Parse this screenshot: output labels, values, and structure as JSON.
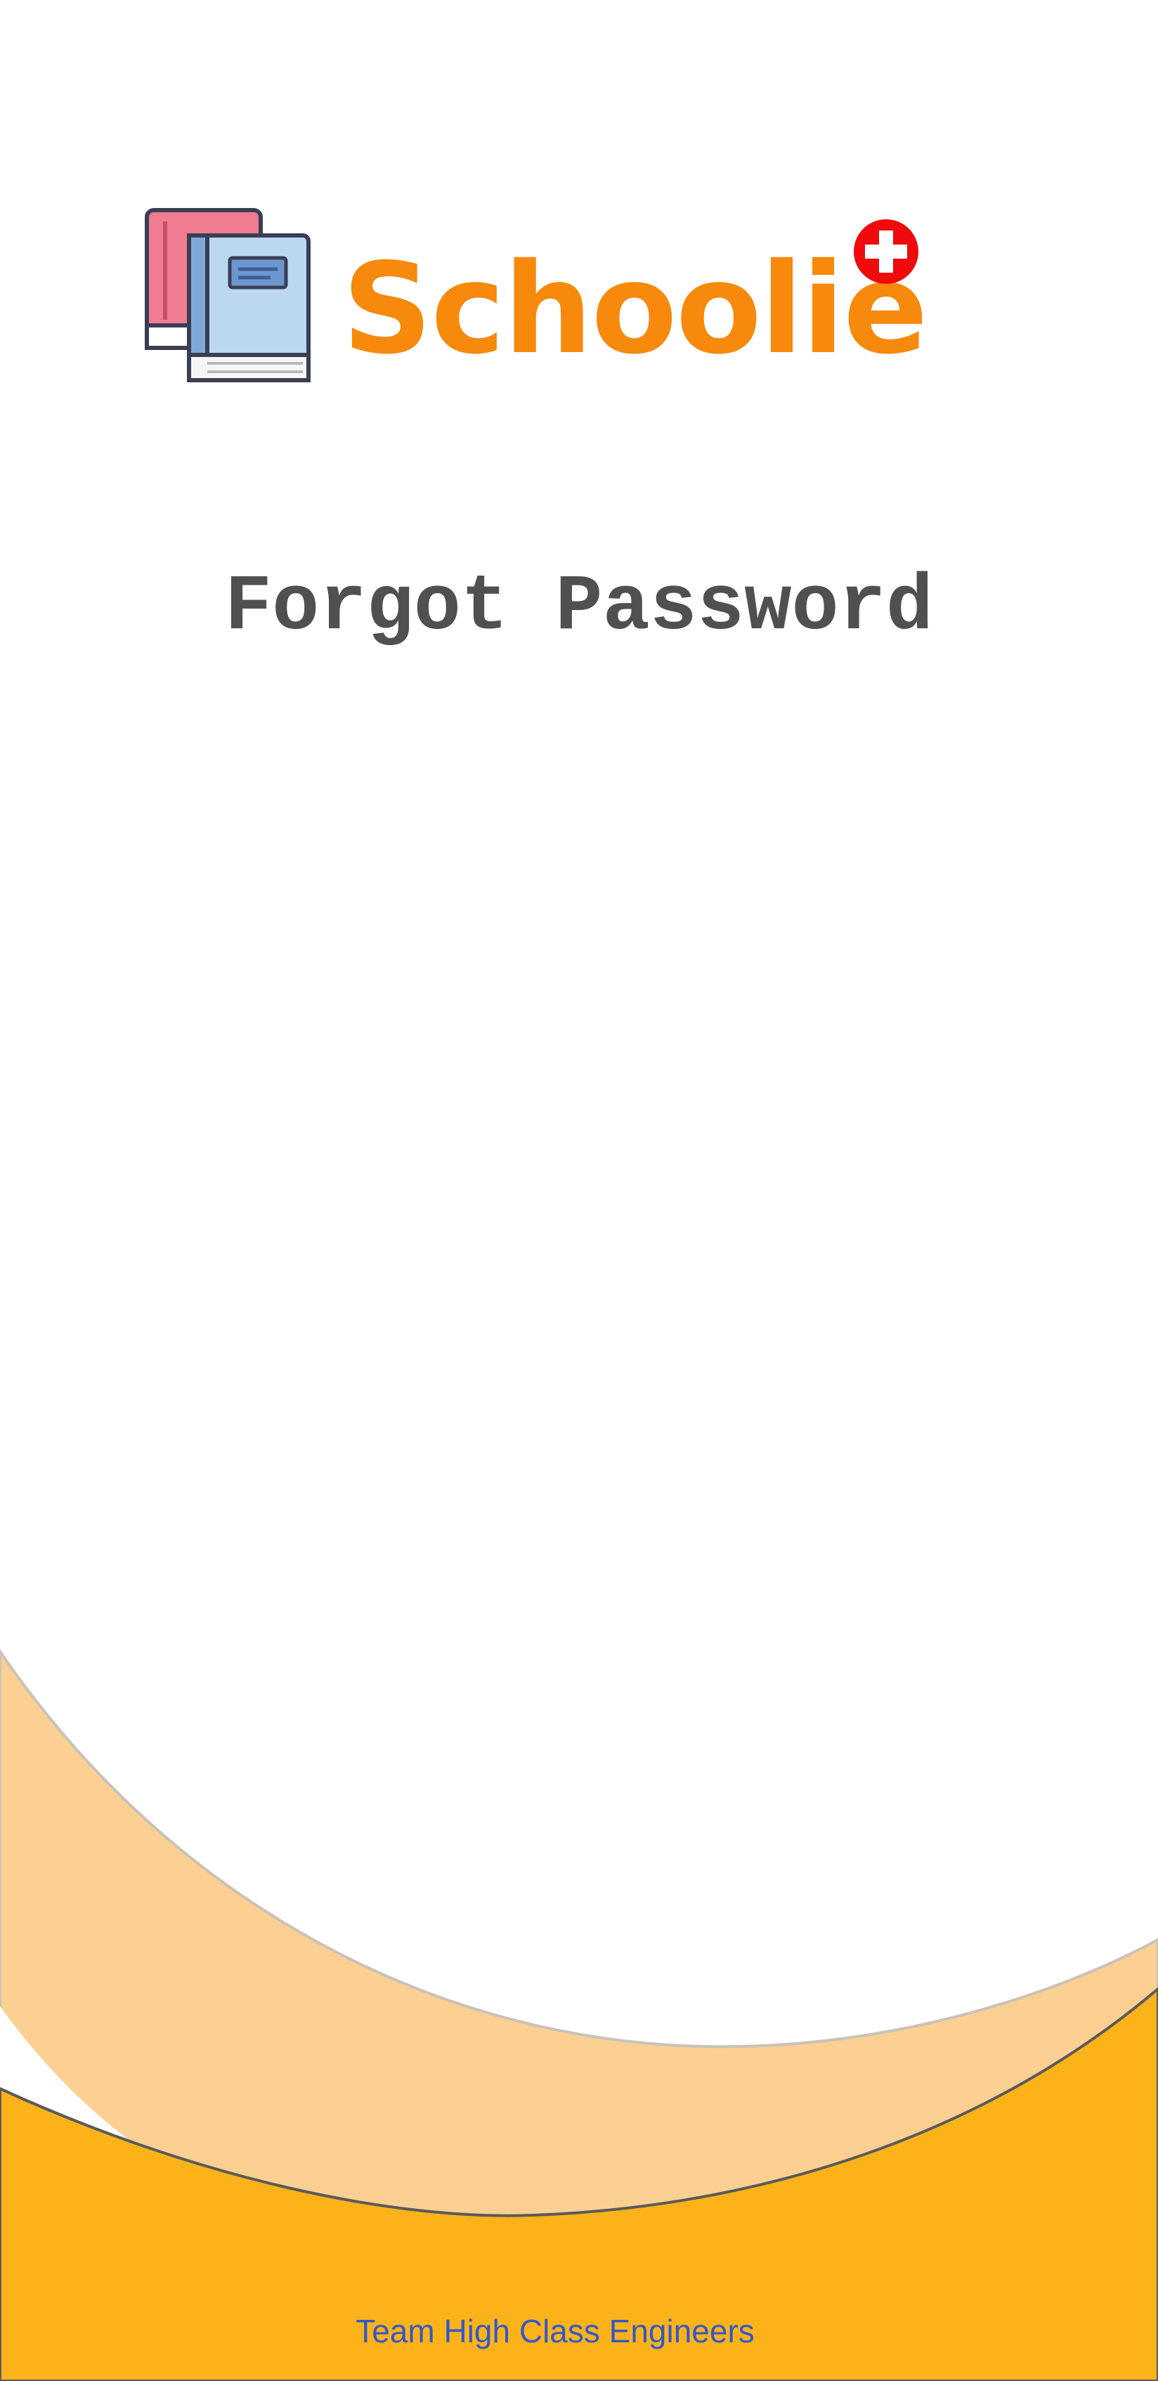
{
  "brand": {
    "name": "Schoolie",
    "name_color": "#f7890c",
    "icon": "books-icon",
    "badge_icon": "plus-badge-icon",
    "badge_color": "#ef0b0b"
  },
  "page": {
    "title": "Forgot Password"
  },
  "footer": {
    "credit": "Team High Class Engineers"
  },
  "theme": {
    "accent_light": "#fbd092",
    "accent_dark": "#fcb31a",
    "text_dark": "#505050",
    "link_blue": "#3558c8"
  }
}
